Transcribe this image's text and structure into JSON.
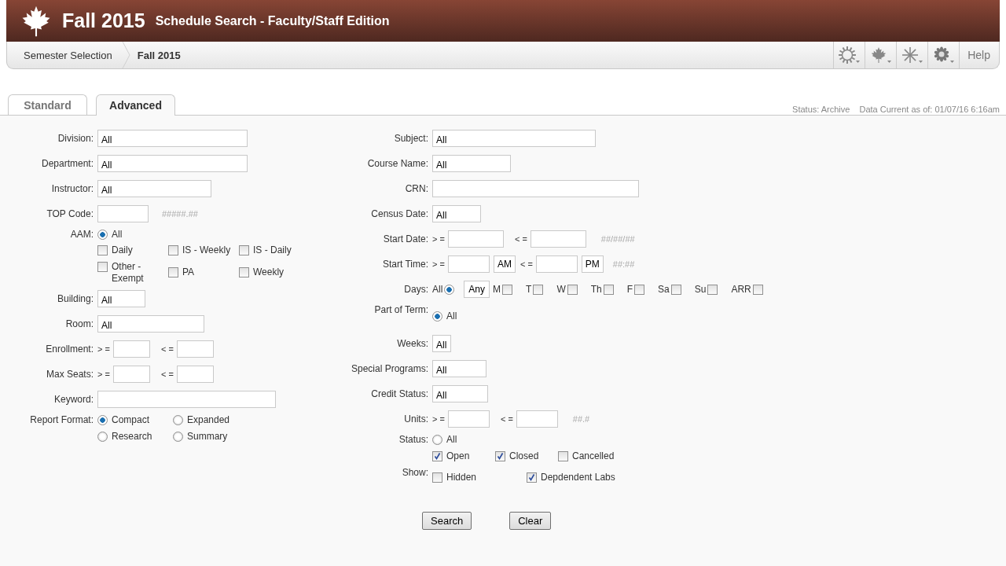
{
  "header": {
    "term": "Fall 2015",
    "title": "Schedule Search - Faculty/Staff Edition"
  },
  "breadcrumbs": [
    {
      "label": "Semester Selection",
      "current": false
    },
    {
      "label": "Fall 2015",
      "current": true
    }
  ],
  "toolbar": {
    "help": "Help"
  },
  "tabs": [
    {
      "label": "Standard",
      "selected": false
    },
    {
      "label": "Advanced",
      "selected": true
    }
  ],
  "status": "Status: Archive",
  "data_current": "Data Current as of: 01/07/16 6:16am",
  "left_fields": [
    {
      "kind": "text",
      "label": "Division:",
      "value": "All"
    },
    {
      "kind": "text",
      "label": "Department:",
      "value": "All"
    },
    {
      "kind": "text",
      "label": "Instructor:",
      "value": "All"
    },
    {
      "kind": "text",
      "label": "TOP Code:",
      "hint": "#####.##"
    },
    {
      "kind": "options",
      "label": "AAM:",
      "lines": [
        [
          {
            "kind": "radio",
            "label": "All",
            "checked": true
          }
        ],
        [
          {
            "kind": "checkbox",
            "label": "Daily",
            "checked": false
          },
          {
            "kind": "checkbox",
            "label": "IS - Weekly",
            "checked": false
          },
          {
            "kind": "checkbox",
            "label": "IS - Daily",
            "checked": false
          }
        ],
        [
          {
            "kind": "checkbox",
            "label": "Other - Exempt",
            "checked": false
          },
          {
            "kind": "checkbox",
            "label": "PA",
            "checked": false
          },
          {
            "kind": "checkbox",
            "label": "Weekly",
            "checked": false
          }
        ]
      ]
    },
    {
      "kind": "text",
      "label": "Building:",
      "value": "All"
    },
    {
      "kind": "text",
      "label": "Room:",
      "value": "All"
    },
    {
      "kind": "range",
      "label": "Enrollment:",
      "from_op": "> =",
      "to_op": "< ="
    },
    {
      "kind": "range",
      "label": "Max Seats:",
      "from_op": "> =",
      "to_op": "< ="
    },
    {
      "kind": "text",
      "label": "Keyword:"
    },
    {
      "kind": "options",
      "label": "Report Format:",
      "lines": [
        [
          {
            "kind": "radio",
            "label": "Compact",
            "checked": true
          },
          {
            "kind": "radio",
            "label": "Expanded",
            "checked": false
          }
        ],
        [
          {
            "kind": "radio",
            "label": "Research",
            "checked": false
          },
          {
            "kind": "radio",
            "label": "Summary",
            "checked": false
          }
        ]
      ]
    }
  ],
  "right_fields": [
    {
      "kind": "text",
      "label": "Subject:",
      "value": "All"
    },
    {
      "kind": "text",
      "label": "Course Name:",
      "value": "All"
    },
    {
      "kind": "text",
      "label": "CRN:"
    },
    {
      "kind": "text",
      "label": "Census Date:",
      "value": "All"
    },
    {
      "kind": "range",
      "label": "Start Date:",
      "from_op": "> =",
      "to_op": "< =",
      "hint": "##/##/##"
    },
    {
      "kind": "range",
      "label": "Start Time:",
      "from_op": "> =",
      "from_suffix": "AM",
      "to_op": "< =",
      "to_suffix": "PM",
      "hint": "##:##"
    },
    {
      "kind": "days",
      "label": "Days:",
      "all_label": "All",
      "all_selected": true,
      "any": "Any",
      "days": [
        {
          "label": "M",
          "checked": false
        },
        {
          "label": "T",
          "checked": false
        },
        {
          "label": "W",
          "checked": false
        },
        {
          "label": "Th",
          "checked": false
        },
        {
          "label": "F",
          "checked": false
        },
        {
          "label": "Sa",
          "checked": false
        },
        {
          "label": "Su",
          "checked": false
        },
        {
          "label": "ARR",
          "checked": false
        }
      ]
    },
    {
      "kind": "options",
      "label": "Part of Term:",
      "lines": [
        [
          {
            "kind": "radio",
            "label": "All",
            "checked": true
          }
        ]
      ]
    },
    {
      "kind": "text",
      "label": "Weeks:",
      "value": "All"
    },
    {
      "kind": "text",
      "label": "Special Programs:",
      "value": "All"
    },
    {
      "kind": "text",
      "label": "Credit Status:",
      "value": "All"
    },
    {
      "kind": "range",
      "label": "Units:",
      "from_op": "> =",
      "to_op": "< =",
      "hint": "##.#"
    },
    {
      "kind": "options",
      "label": "Status:",
      "lines": [
        [
          {
            "kind": "radio",
            "label": "All",
            "checked": false
          }
        ],
        [
          {
            "kind": "checkbox",
            "label": "Open",
            "checked": true
          },
          {
            "kind": "checkbox",
            "label": "Closed",
            "checked": true
          },
          {
            "kind": "checkbox",
            "label": "Cancelled",
            "checked": false
          }
        ]
      ]
    },
    {
      "kind": "options",
      "label": "Show:",
      "lines": [
        [
          {
            "kind": "checkbox",
            "label": "Hidden",
            "checked": false
          },
          {
            "kind": "checkbox",
            "label": "Depdendent Labs",
            "checked": true
          }
        ]
      ]
    }
  ],
  "buttons": [
    "Search",
    "Clear"
  ]
}
